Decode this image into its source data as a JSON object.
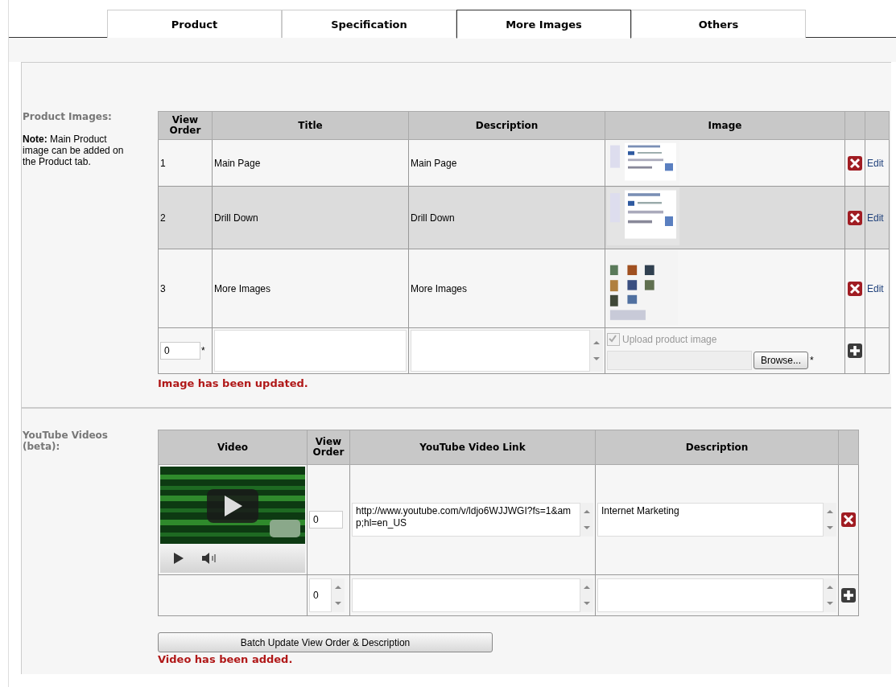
{
  "tabs": [
    {
      "label": "Product",
      "selected": false
    },
    {
      "label": "Specification",
      "selected": false
    },
    {
      "label": "More Images",
      "selected": true
    },
    {
      "label": "Others",
      "selected": false
    }
  ],
  "product_images": {
    "label": "Product Images:",
    "note": "**Note:** Main Product image can be added on the Product tab.",
    "columns": [
      "View Order",
      "Title",
      "Description",
      "Image"
    ],
    "rows": [
      {
        "view_order": "1",
        "title": "Main Page",
        "description": "Main Page",
        "action": "Edit",
        "selected": false
      },
      {
        "view_order": "2",
        "title": "Drill Down",
        "description": "Drill Down",
        "action": "Edit",
        "selected": true
      },
      {
        "view_order": "3",
        "title": "More Images",
        "description": "More Images",
        "action": "Edit",
        "selected": false
      }
    ],
    "new_row": {
      "view_order": "0",
      "view_order_mark": "*",
      "upload_label": "Upload product image",
      "upload_checked": true,
      "upload_disabled": true,
      "browse_button": "Browse...",
      "browse_mark": "*"
    },
    "message": "Image has been updated."
  },
  "youtube_videos": {
    "label": "YouTube Videos (beta):",
    "columns": [
      "Video",
      "View Order",
      "YouTube Video Link",
      "Description"
    ],
    "rows": [
      {
        "view_order": "0",
        "link": "http://www.youtube.com/v/ldjo6WJJWGI?fs=1&amp;hl=en_US",
        "description": "Internet Marketing"
      }
    ],
    "new_row": {
      "view_order": "0"
    },
    "batch_button": "Batch Update View Order & Description",
    "message": "Video has been added."
  }
}
